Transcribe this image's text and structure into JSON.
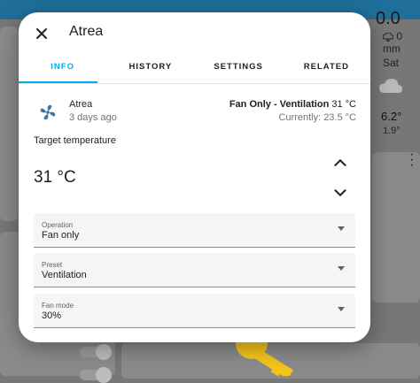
{
  "dialog": {
    "title": "Atrea",
    "close_icon": "close-icon"
  },
  "tabs": [
    {
      "label": "INFO",
      "active": true
    },
    {
      "label": "HISTORY",
      "active": false
    },
    {
      "label": "SETTINGS",
      "active": false
    },
    {
      "label": "RELATED",
      "active": false
    }
  ],
  "entity": {
    "icon": "fan-icon",
    "name": "Atrea",
    "last_changed": "3 days ago",
    "state_mode": "Fan Only - Ventilation",
    "state_temp": "31 °C",
    "current": "Currently: 23.5 °C"
  },
  "target": {
    "label": "Target temperature",
    "value": "31 °C",
    "up_icon": "chevron-up-icon",
    "down_icon": "chevron-down-icon"
  },
  "selects": [
    {
      "label": "Operation",
      "value": "Fan only"
    },
    {
      "label": "Preset",
      "value": "Ventilation"
    },
    {
      "label": "Fan mode",
      "value": "30%"
    }
  ],
  "background": {
    "weather_top": "0.0",
    "weather_mm": "0 mm",
    "weather_day": "Sat",
    "weather_temp": "6.2°",
    "weather_low": "1.9°"
  },
  "colors": {
    "accent": "#03a9f4",
    "fan_icon": "#44739e",
    "header": "#1f6f9a",
    "key_icon": "#f2c41c"
  }
}
